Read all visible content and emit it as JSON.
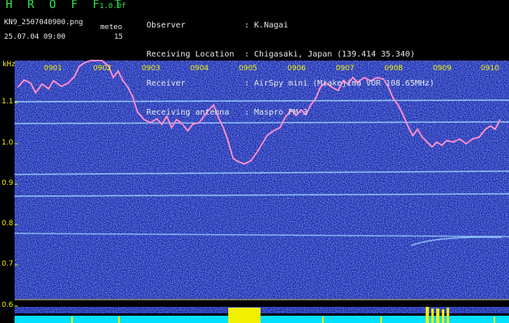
{
  "header": {
    "brand": "H R O F F T",
    "version": "1.0.0f",
    "filename": "KN9_2507040900.png",
    "mode": "meteo",
    "timestamp": "25.07.04 09:00",
    "count": "15"
  },
  "info": [
    {
      "label": "Observer",
      "value": ": K.Nagai"
    },
    {
      "label": "Receiving Location",
      "value": ": Chigasaki, Japan (139.414 35.340)"
    },
    {
      "label": "Receiver",
      "value": ": AirSpy mini (Miakejima VOR 108.65MHz)"
    },
    {
      "label": "Receiving antenna",
      "value": ": Maspro FM-3"
    }
  ],
  "axis": {
    "unit": "kHz",
    "y_ticks": [
      "1.1",
      "1.0",
      "0.9",
      "0.8",
      "0.7",
      "0.6"
    ],
    "x_ticks": [
      "0901",
      "0902",
      "0903",
      "0904",
      "0905",
      "0906",
      "0907",
      "0908",
      "0909",
      "0910"
    ]
  },
  "colors": {
    "background": "#000000",
    "spectrum_base": "#0b1a9a",
    "trace": "#f070c0",
    "label": "#f0f000",
    "brand": "#2ee84a",
    "signal_bar": "#00e0ff"
  }
}
